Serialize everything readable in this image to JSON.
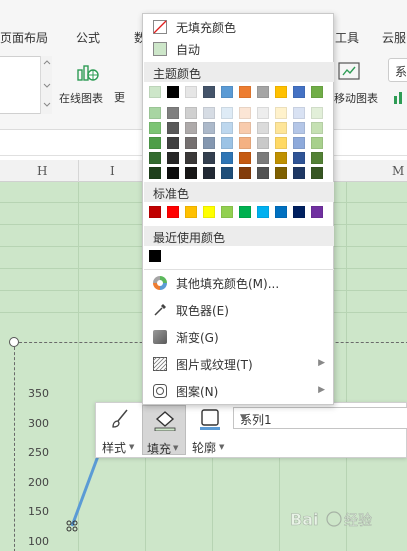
{
  "ribbon": {
    "tabs": [
      "页面布局",
      "公式",
      "数",
      "工具",
      "云服"
    ],
    "online_chart": "在线图表",
    "more": "更",
    "move_chart": "移动图表",
    "right_combo": "系"
  },
  "columns": [
    "H",
    "I",
    "M"
  ],
  "chart": {
    "y_ticks": [
      "350",
      "300",
      "250",
      "200",
      "150",
      "100"
    ],
    "series_start": 130
  },
  "fill_menu": {
    "no_fill": "无填充颜色",
    "auto": "自动",
    "theme_colors_title": "主题颜色",
    "standard_colors_title": "标准色",
    "recent_colors_title": "最近使用颜色",
    "more_colors": "其他填充颜色(M)...",
    "eyedropper": "取色器(E)",
    "gradient": "渐变(G)",
    "picture_texture": "图片或纹理(T)",
    "pattern": "图案(N)",
    "auto_swatch": "#cde6c9",
    "theme_top": [
      "#cde6c9",
      "#000000",
      "#e6e6e6",
      "#44546a",
      "#5b9bd5",
      "#ed7d31",
      "#a5a5a5",
      "#ffc000",
      "#4472c4",
      "#70ad47"
    ],
    "theme_shades": [
      [
        "#a8d5a2",
        "#7f7f7f",
        "#d0d0d0",
        "#d6dce4",
        "#deebf6",
        "#fbe5d5",
        "#ededed",
        "#fff2cc",
        "#d9e2f3",
        "#e2efd9"
      ],
      [
        "#7cc474",
        "#595959",
        "#aeaaaa",
        "#acb9ca",
        "#bdd7ee",
        "#f8cbad",
        "#dbdbdb",
        "#fee599",
        "#b4c6e7",
        "#c5e0b3"
      ],
      [
        "#4f9e49",
        "#3f3f3f",
        "#757070",
        "#8497b0",
        "#9cc3e5",
        "#f4b183",
        "#c9c9c9",
        "#ffd965",
        "#8eaadb",
        "#a8d08d"
      ],
      [
        "#336b2f",
        "#262626",
        "#3a3838",
        "#333f4f",
        "#2e75b5",
        "#c55a11",
        "#7b7b7b",
        "#bf9000",
        "#2f5496",
        "#538135"
      ],
      [
        "#1e3f1b",
        "#0d0d0d",
        "#171616",
        "#222a35",
        "#1f4e79",
        "#833c0b",
        "#525252",
        "#7f6000",
        "#1f3864",
        "#375623"
      ]
    ],
    "standard": [
      "#c00000",
      "#ff0000",
      "#ffc000",
      "#ffff00",
      "#92d050",
      "#00b050",
      "#00b0f0",
      "#0070c0",
      "#002060",
      "#7030a0"
    ],
    "recent": [
      "#000000"
    ]
  },
  "float_toolbar": {
    "style_label": "样式",
    "fill_label": "填充",
    "outline_label": "轮廓",
    "series_value": "系列1"
  },
  "watermark": "Bai 经验"
}
